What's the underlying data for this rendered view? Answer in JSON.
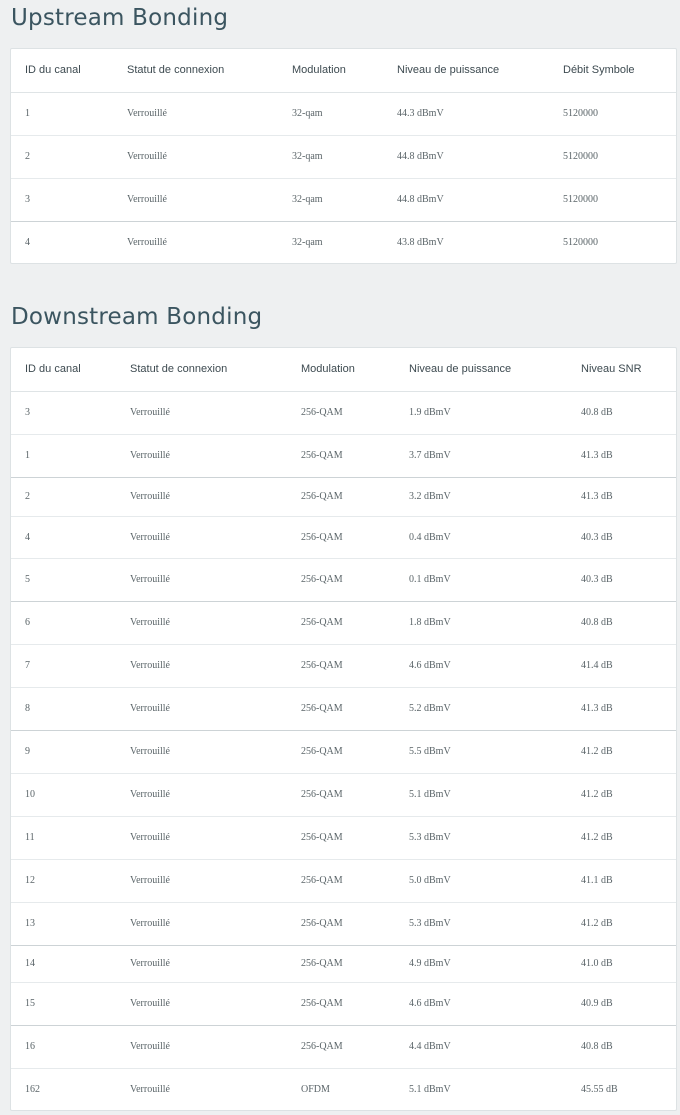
{
  "upstream": {
    "title": "Upstream Bonding",
    "columns": [
      "ID du canal",
      "Statut de connexion",
      "Modulation",
      "Niveau de puissance",
      "Débit Symbole"
    ],
    "rows": [
      [
        "1",
        "Verrouillé",
        "32-qam",
        "44.3 dBmV",
        "5120000"
      ],
      [
        "2",
        "Verrouillé",
        "32-qam",
        "44.8 dBmV",
        "5120000"
      ],
      [
        "3",
        "Verrouillé",
        "32-qam",
        "44.8 dBmV",
        "5120000"
      ],
      [
        "4",
        "Verrouillé",
        "32-qam",
        "43.8 dBmV",
        "5120000"
      ]
    ]
  },
  "downstream": {
    "title": "Downstream Bonding",
    "columns": [
      "ID du canal",
      "Statut de connexion",
      "Modulation",
      "Niveau de puissance",
      "Niveau SNR"
    ],
    "rows": [
      [
        "3",
        "Verrouillé",
        "256-QAM",
        "1.9 dBmV",
        "40.8 dB"
      ],
      [
        "1",
        "Verrouillé",
        "256-QAM",
        "3.7 dBmV",
        "41.3 dB"
      ],
      [
        "2",
        "Verrouillé",
        "256-QAM",
        "3.2 dBmV",
        "41.3 dB"
      ],
      [
        "4",
        "Verrouillé",
        "256-QAM",
        "0.4 dBmV",
        "40.3 dB"
      ],
      [
        "5",
        "Verrouillé",
        "256-QAM",
        "0.1 dBmV",
        "40.3 dB"
      ],
      [
        "6",
        "Verrouillé",
        "256-QAM",
        "1.8 dBmV",
        "40.8 dB"
      ],
      [
        "7",
        "Verrouillé",
        "256-QAM",
        "4.6 dBmV",
        "41.4 dB"
      ],
      [
        "8",
        "Verrouillé",
        "256-QAM",
        "5.2 dBmV",
        "41.3 dB"
      ],
      [
        "9",
        "Verrouillé",
        "256-QAM",
        "5.5 dBmV",
        "41.2 dB"
      ],
      [
        "10",
        "Verrouillé",
        "256-QAM",
        "5.1 dBmV",
        "41.2 dB"
      ],
      [
        "11",
        "Verrouillé",
        "256-QAM",
        "5.3 dBmV",
        "41.2 dB"
      ],
      [
        "12",
        "Verrouillé",
        "256-QAM",
        "5.0 dBmV",
        "41.1 dB"
      ],
      [
        "13",
        "Verrouillé",
        "256-QAM",
        "5.3 dBmV",
        "41.2 dB"
      ],
      [
        "14",
        "Verrouillé",
        "256-QAM",
        "4.9 dBmV",
        "41.0 dB"
      ],
      [
        "15",
        "Verrouillé",
        "256-QAM",
        "4.6 dBmV",
        "40.9 dB"
      ],
      [
        "16",
        "Verrouillé",
        "256-QAM",
        "4.4 dBmV",
        "40.8 dB"
      ],
      [
        "162",
        "Verrouillé",
        "OFDM",
        "5.1 dBmV",
        "45.55 dB"
      ]
    ]
  }
}
